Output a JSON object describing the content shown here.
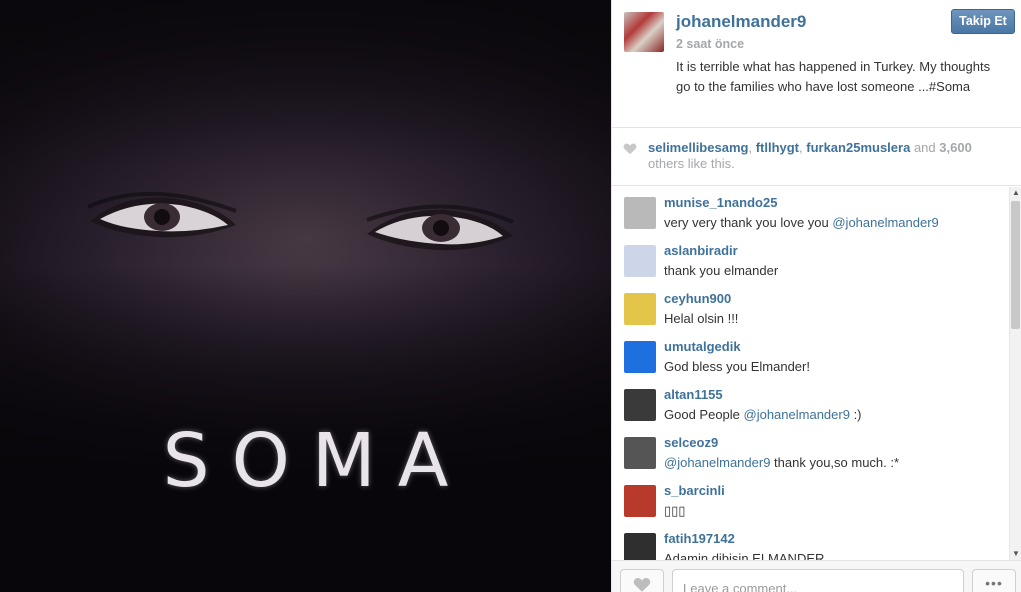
{
  "photo": {
    "overlay_text": "SOMA"
  },
  "post": {
    "username": "johanelmander9",
    "time": "2 saat önce",
    "caption": "It is terrible what has happened in Turkey. My thoughts go to the families who have lost someone ...#Soma",
    "follow_label": "Takip Et"
  },
  "likes": {
    "users": [
      "selimellibesamg",
      "ftllhygt",
      "furkan25muslera"
    ],
    "separator": ", ",
    "and_text": "and",
    "count": "3,600",
    "suffix": "others like this."
  },
  "comments": [
    {
      "user": "munise_1nando25",
      "text": "very very thank you love you ",
      "mention": "@johanelmander9",
      "after": ""
    },
    {
      "user": "aslanbiradir",
      "text": "thank you elmander",
      "mention": "",
      "after": ""
    },
    {
      "user": "ceyhun900",
      "text": "Helal olsin !!!",
      "mention": "",
      "after": ""
    },
    {
      "user": "umutalgedik",
      "text": "God bless you Elmander!",
      "mention": "",
      "after": ""
    },
    {
      "user": "altan1155",
      "text": "Good People ",
      "mention": "@johanelmander9",
      "after": " :)"
    },
    {
      "user": "selceoz9",
      "text": "",
      "mention": "@johanelmander9",
      "after": " thank you,so much. :*"
    },
    {
      "user": "s_barcinli",
      "text": "▯▯▯",
      "mention": "",
      "after": ""
    },
    {
      "user": "fatih197142",
      "text": "Adamin dibisin ELMANDER",
      "mention": "",
      "after": ""
    }
  ],
  "comment_avatar_colors": [
    "#b9b9b9",
    "#cdd6e8",
    "#e3c54a",
    "#1e6fe0",
    "#3a3a3a",
    "#555555",
    "#b83a2a",
    "#2f2f2f"
  ],
  "footer": {
    "comment_placeholder": "Leave a comment...",
    "more_label": "•••"
  },
  "colors": {
    "link": "#3f729b",
    "muted": "#a5a7aa",
    "follow_button": "#4a77a6"
  },
  "icons": {
    "like": "heart-icon",
    "more": "ellipsis-icon",
    "scroll_up": "arrow-up-icon",
    "scroll_down": "arrow-down-icon"
  }
}
